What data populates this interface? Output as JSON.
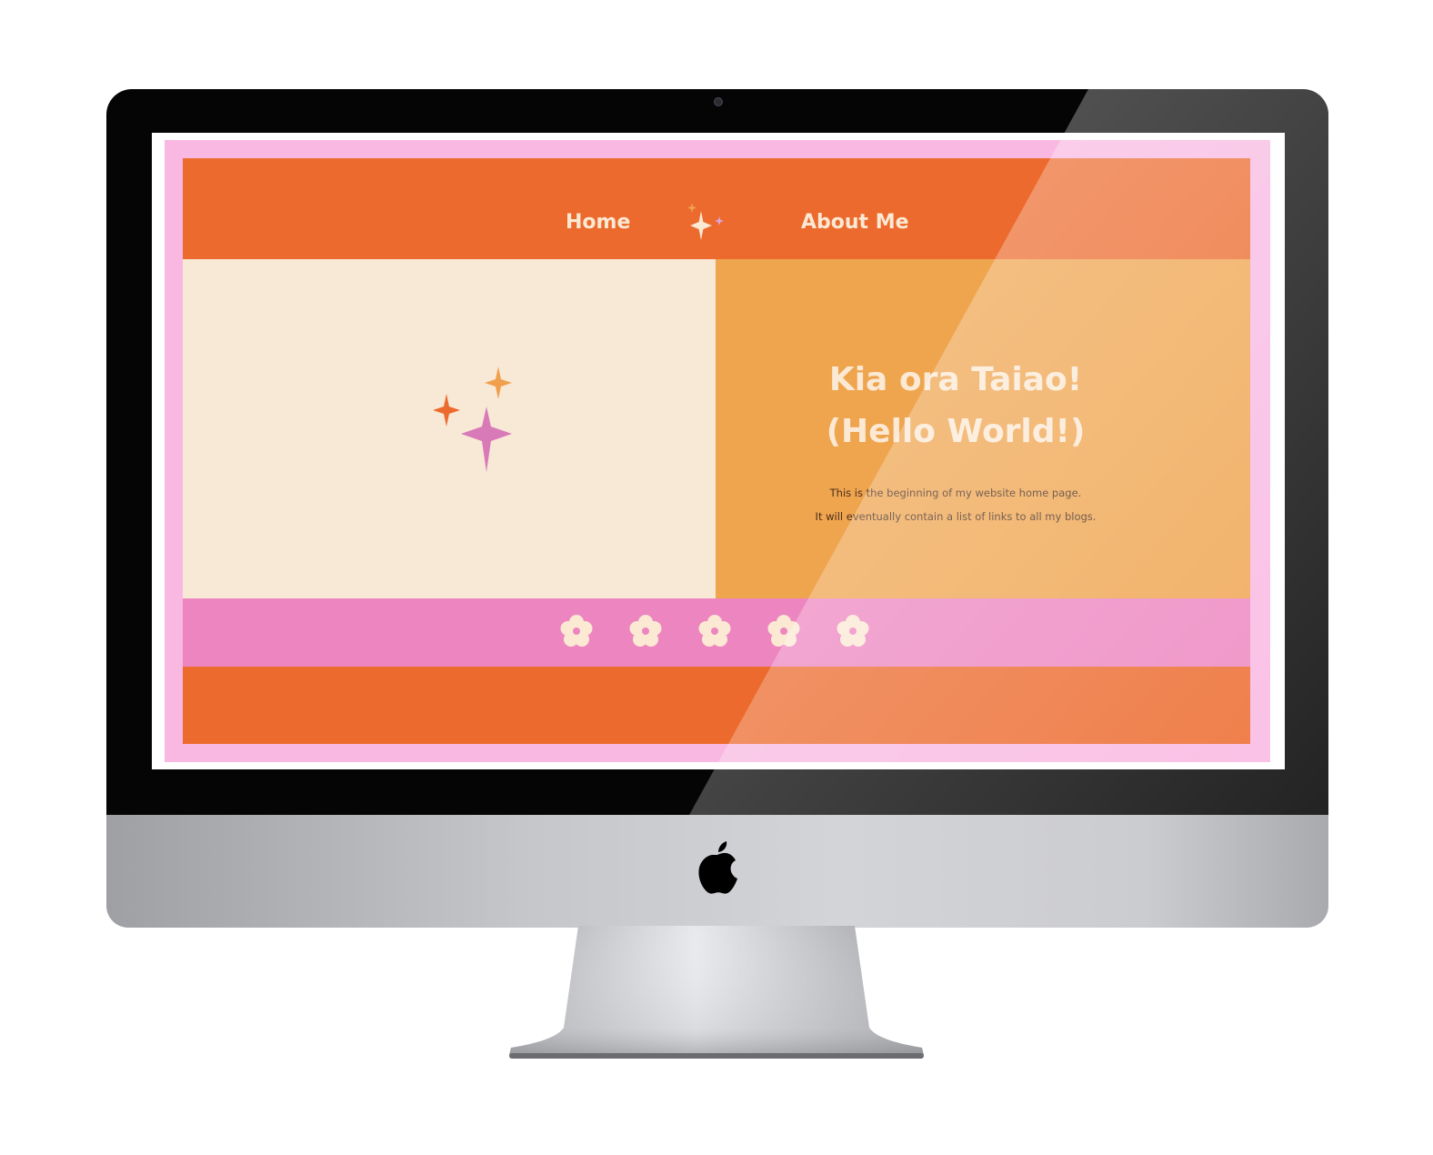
{
  "site": {
    "nav": {
      "home_label": "Home",
      "about_label": "About Me"
    },
    "hero": {
      "title_line1": "Kia ora Taiao!",
      "title_line2": "(Hello World!)",
      "paragraph_line1": "This is the beginning of my website home page.",
      "paragraph_line2": "It will eventually contain a list of links to all my blogs."
    },
    "flower_count": 5
  },
  "colors": {
    "pink_frame": "#f9b8e2",
    "orange": "#ec6a2d",
    "light_orange": "#efa44e",
    "cream": "#f8e8d6",
    "pink_band": "#ed86c0",
    "cream_text": "#fbe9d4",
    "sparkle_pink": "#d97ab8",
    "sparkle_orange": "#f0a04c"
  },
  "icons": [
    "sparkles-icon",
    "flower-icon",
    "apple-logo-icon",
    "camera-icon"
  ]
}
